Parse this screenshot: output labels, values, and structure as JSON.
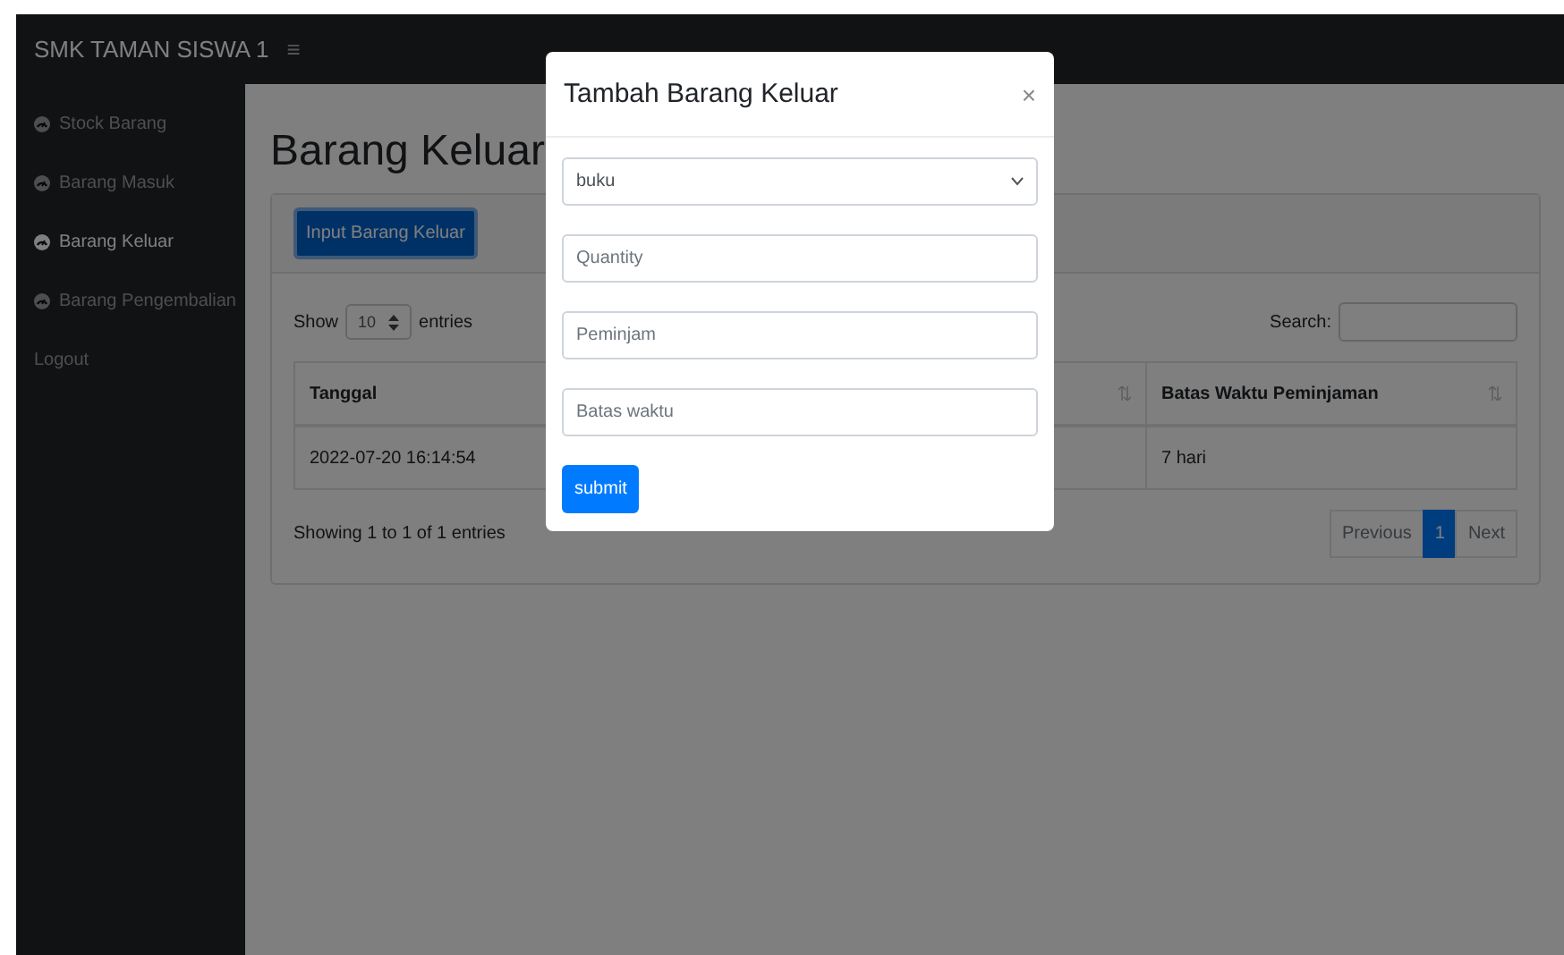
{
  "topbar": {
    "brand": "SMK TAMAN SISWA 1",
    "menu_toggle": "≡"
  },
  "sidebar": {
    "items": [
      {
        "label": "Stock Barang",
        "kind": "nav",
        "selected": false
      },
      {
        "label": "Barang Masuk",
        "kind": "nav",
        "selected": false
      },
      {
        "label": "Barang Keluar",
        "kind": "nav",
        "selected": true
      },
      {
        "label": "Barang Pengembalian",
        "kind": "nav",
        "selected": false
      },
      {
        "label": "Logout",
        "kind": "plain",
        "selected": false
      }
    ]
  },
  "page_title": "Barang Keluar",
  "card": {
    "button": "Input Barang Keluar",
    "length": {
      "before": "Show",
      "value": "10",
      "after": "entries"
    },
    "search": {
      "label": "Search:"
    },
    "table": {
      "columns": [
        {
          "label": "Tanggal"
        },
        {
          "sort_icon": true
        },
        {
          "label": "Batas Waktu Peminjaman",
          "sort_icon": true
        }
      ],
      "rows": [
        [
          "2022-07-20 16:14:54",
          "",
          "7 hari"
        ]
      ]
    },
    "info": "Showing 1 to 1 of 1 entries",
    "pagination": [
      {
        "label": "Previous",
        "selected": false
      },
      {
        "label": "1",
        "selected": true
      },
      {
        "label": "Next",
        "selected": false
      }
    ]
  },
  "modal": {
    "title": "Tambah Barang Keluar",
    "close": "×",
    "fields": [
      {
        "kind": "select",
        "value": "buku"
      },
      {
        "kind": "input",
        "placeholder": "Quantity"
      },
      {
        "kind": "input",
        "placeholder": "Peminjam"
      },
      {
        "kind": "input",
        "placeholder": "Batas waktu"
      }
    ],
    "submit": "submit"
  }
}
